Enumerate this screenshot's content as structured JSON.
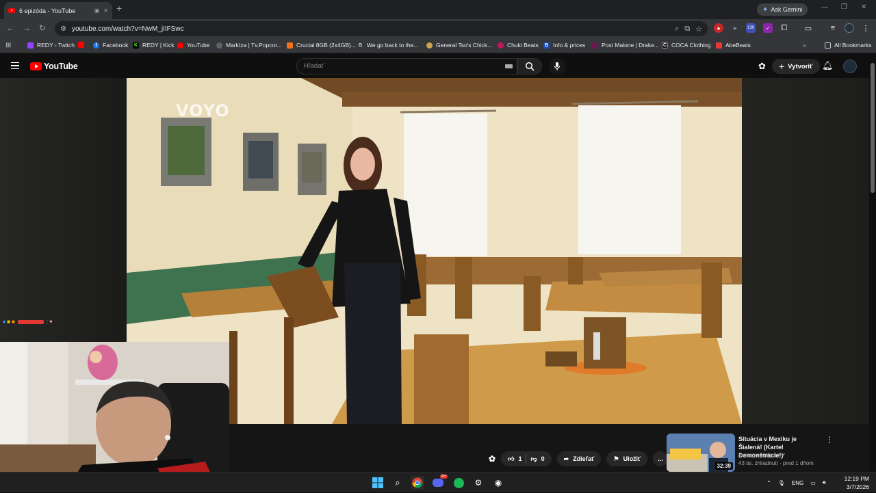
{
  "browser": {
    "tab_title": "6 epizóda - YouTube",
    "new_tab_glyph": "+",
    "ask_gemini": "Ask Gemini",
    "url": "youtube.com/watch?v=NwM_jIIFSwc",
    "bookmarks": [
      {
        "label": "REDY - Twitch",
        "color": "#9146ff",
        "icon": "twitch-icon"
      },
      {
        "label": "",
        "color": "#ff0000",
        "icon": "youtube-icon"
      },
      {
        "label": "Facebook",
        "color": "#1877f2",
        "icon": "facebook-icon"
      },
      {
        "label": "REDY | Kick",
        "color": "#53fc18",
        "icon": "kick-icon"
      },
      {
        "label": "YouTube",
        "color": "#ff0000",
        "icon": "youtube-icon"
      },
      {
        "label": "Markíza | Tv.Popcor...",
        "color": "#9aa0a6",
        "icon": "globe-icon"
      },
      {
        "label": "Crucial 8GB (2x4GB)...",
        "color": "#f2711c",
        "icon": "crucial-icon"
      },
      {
        "label": "We go back to the...",
        "color": "#9aa0a6",
        "icon": "google-icon"
      },
      {
        "label": "General Tso's Chick...",
        "color": "#c9a44a",
        "icon": "recipe-icon"
      },
      {
        "label": "Chuki Beats",
        "color": "#c2185b",
        "icon": "chuki-icon"
      },
      {
        "label": "Info & prices",
        "color": "#1a4bb5",
        "icon": "b-icon"
      },
      {
        "label": "Post Malone | Drake...",
        "color": "#6a1b4d",
        "icon": "genius-icon"
      },
      {
        "label": "COCA Clothing",
        "color": "#333333",
        "icon": "coca-icon"
      },
      {
        "label": "AbeBeats",
        "color": "#e53935",
        "icon": "abebeats-icon"
      }
    ],
    "all_bookmarks": "All Bookmarks",
    "extension_badge": "130"
  },
  "youtube": {
    "logo_text": "YouTube",
    "search_placeholder": "Hľadať",
    "create_label": "Vytvoriť",
    "watermark": "VOYO",
    "actions": {
      "likes": "1",
      "dislikes": "0",
      "share": "Zdieľať",
      "save": "Uložiť",
      "more": "..."
    },
    "recommendation": {
      "title": "Situácia v Mexiku je Šialená! (Kartel Demonštrácie!)",
      "channel": "menameselassie",
      "meta": "43 tis. zhliadnutí · pred 1 dňom",
      "duration": "32:39"
    }
  },
  "chat": {
    "separator": ":"
  },
  "taskbar": {
    "lang": "ENG",
    "time": "12:19 PM",
    "date": "3/7/2026",
    "discord_badge": "9+"
  }
}
